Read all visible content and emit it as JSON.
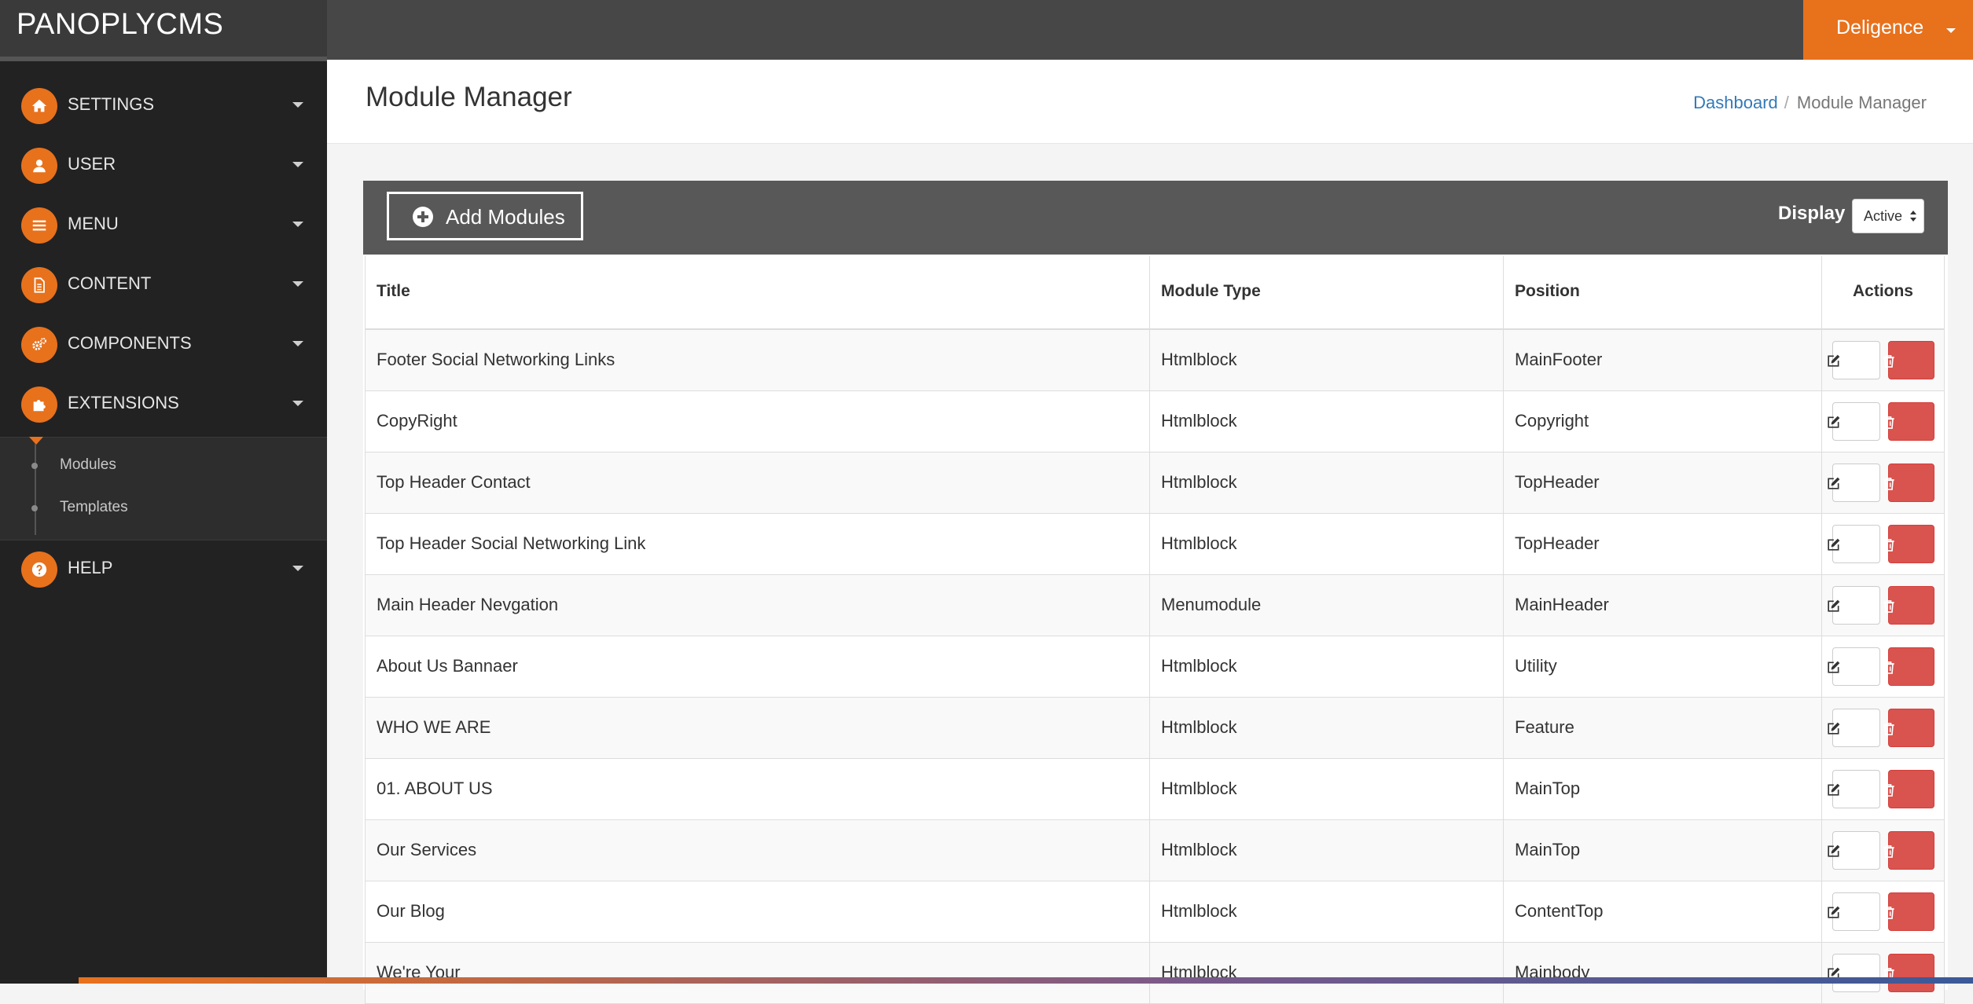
{
  "brand": "PANOPLYCMS",
  "colors": {
    "accent": "#e8711c",
    "danger": "#d9534f",
    "link": "#337ab7",
    "sidebar": "#222222",
    "topbar": "#474747"
  },
  "sidebar": {
    "items": [
      {
        "label": "SETTINGS",
        "icon": "home-icon"
      },
      {
        "label": "USER",
        "icon": "user-icon"
      },
      {
        "label": "MENU",
        "icon": "bars-icon"
      },
      {
        "label": "CONTENT",
        "icon": "file-icon"
      },
      {
        "label": "COMPONENTS",
        "icon": "cogs-icon"
      },
      {
        "label": "EXTENSIONS",
        "icon": "puzzle-icon"
      },
      {
        "label": "HELP",
        "icon": "question-icon"
      }
    ],
    "submenu": [
      {
        "label": "Modules"
      },
      {
        "label": "Templates"
      }
    ]
  },
  "topbar": {
    "user": "Deligence"
  },
  "header": {
    "title": "Module Manager",
    "breadcrumb": {
      "home": "Dashboard",
      "current": "Module Manager"
    }
  },
  "toolbar": {
    "add_label": "Add Modules",
    "display_label": "Display",
    "display_value": "Active"
  },
  "table": {
    "headers": {
      "title": "Title",
      "type": "Module Type",
      "position": "Position",
      "actions": "Actions"
    },
    "rows": [
      {
        "title": "Footer Social Networking Links",
        "type": "Htmlblock",
        "position": "MainFooter"
      },
      {
        "title": "CopyRight",
        "type": "Htmlblock",
        "position": "Copyright"
      },
      {
        "title": "Top Header Contact",
        "type": "Htmlblock",
        "position": "TopHeader"
      },
      {
        "title": "Top Header Social Networking Link",
        "type": "Htmlblock",
        "position": "TopHeader"
      },
      {
        "title": "Main Header Nevgation",
        "type": "Menumodule",
        "position": "MainHeader"
      },
      {
        "title": "About Us Bannaer",
        "type": "Htmlblock",
        "position": "Utility"
      },
      {
        "title": "WHO WE ARE",
        "type": "Htmlblock",
        "position": "Feature"
      },
      {
        "title": "01. ABOUT US",
        "type": "Htmlblock",
        "position": "MainTop"
      },
      {
        "title": "Our Services",
        "type": "Htmlblock",
        "position": "MainTop"
      },
      {
        "title": "Our Blog",
        "type": "Htmlblock",
        "position": "ContentTop"
      },
      {
        "title": "We're Your",
        "type": "Htmlblock",
        "position": "Mainbody"
      }
    ]
  }
}
